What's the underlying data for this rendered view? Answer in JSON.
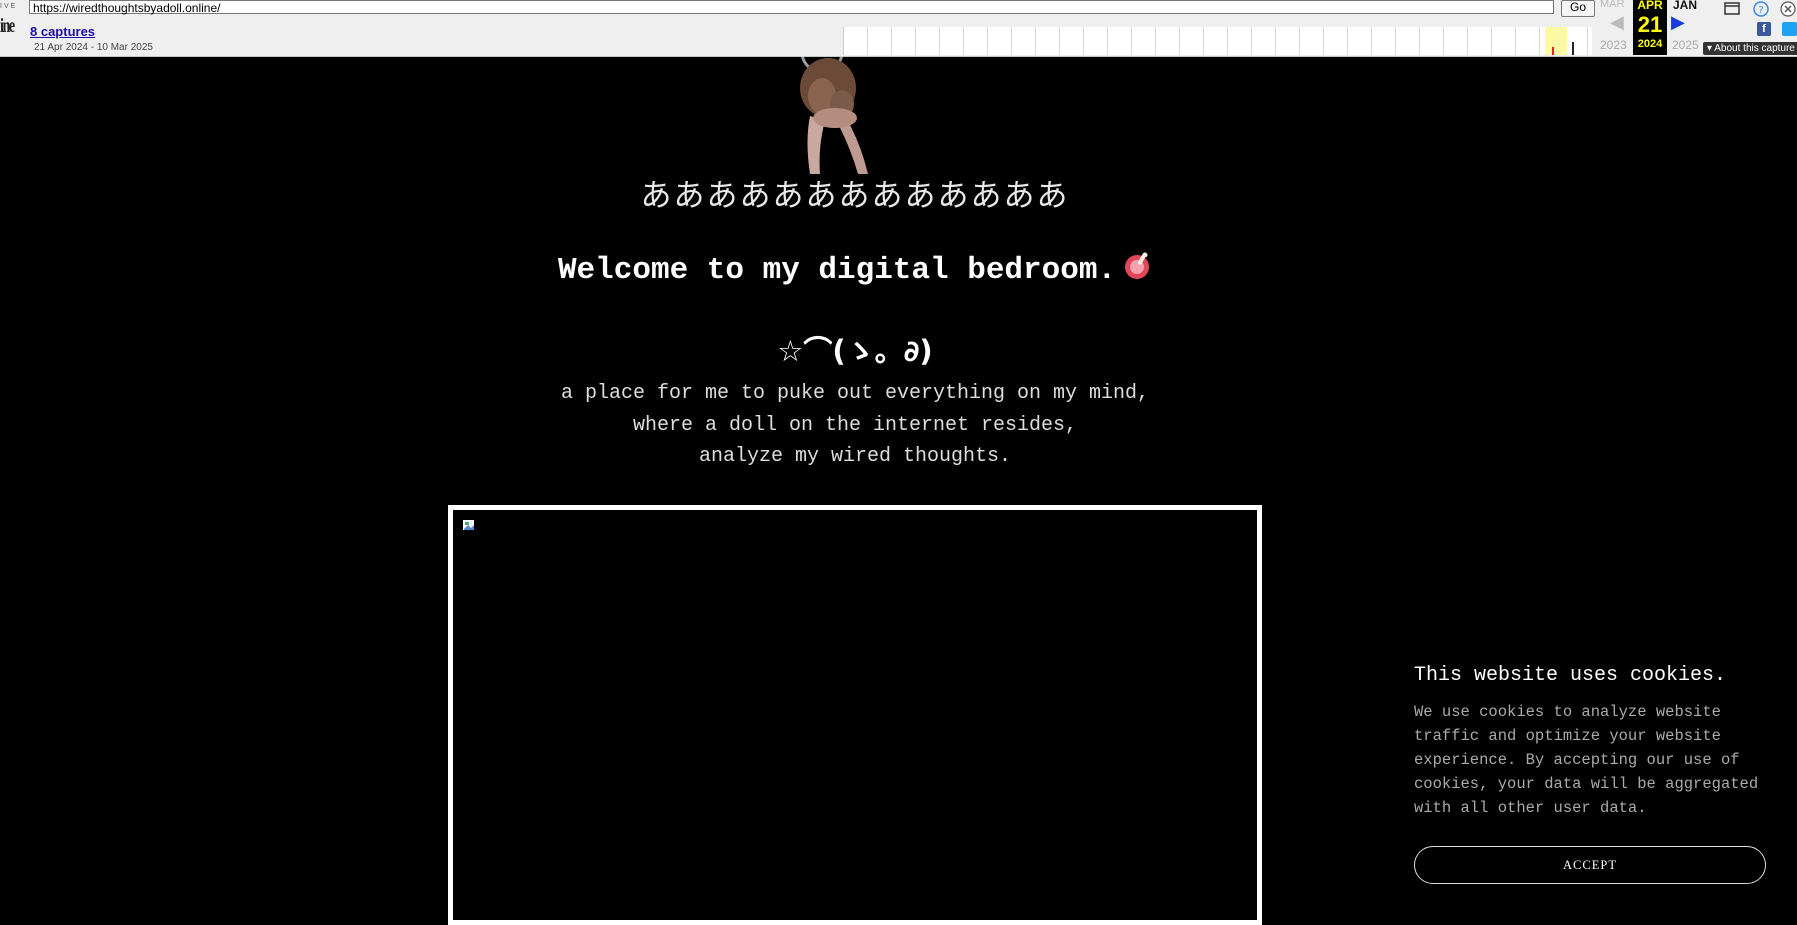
{
  "toolbar": {
    "logo_top": "IVE",
    "logo": "ine",
    "url": "https://wiredthoughtsbyadoll.online/",
    "go_label": "Go",
    "captures_label": "8 captures",
    "date_range": "21 Apr 2024 - 10 Mar 2025",
    "calendar": {
      "prev_month": "MAR",
      "prev_year": "2023",
      "current_month": "APR",
      "current_day": "21",
      "current_year": "2024",
      "next_month": "JAN",
      "next_year": "2025"
    },
    "about_label": "About this capture",
    "colors": {
      "current_bg": "#000000",
      "current_text": "#ffff00",
      "next_arrow": "#1a3de0"
    }
  },
  "page": {
    "glyph_line": "あああああああああああああ",
    "welcome": "Welcome to my digital bedroom.",
    "welcome_emoji": "meat-on-bone-icon",
    "kaomoji": "☆⌒(ゝ。∂)",
    "intro_lines": [
      "a place for me to puke out everything on my mind,",
      "where a doll on the internet resides,",
      "analyze my wired thoughts."
    ],
    "media_icon": "broken-image-icon"
  },
  "cookie_banner": {
    "title": "This website uses cookies.",
    "body": "We use cookies to analyze website traffic and optimize your website experience. By accepting our use of cookies, your data will be aggregated with all other user data.",
    "accept_label": "ACCEPT"
  }
}
